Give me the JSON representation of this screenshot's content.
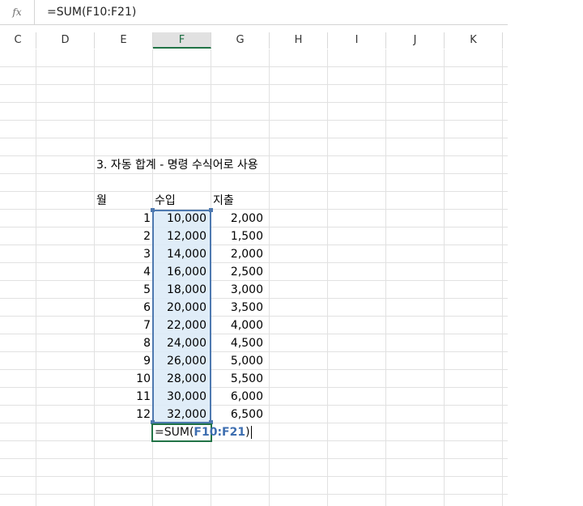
{
  "formula_bar": {
    "fx_label": "fx",
    "formula": "=SUM(F10:F21)"
  },
  "columns": [
    "C",
    "D",
    "E",
    "F",
    "G",
    "H",
    "I",
    "J",
    "K"
  ],
  "sheet": {
    "title": "3. 자동 합계 - 명령 수식어로 사용",
    "headers": {
      "month": "월",
      "income": "수입",
      "expense": "지출"
    },
    "rows": [
      {
        "month": "1",
        "income": "10,000",
        "expense": "2,000"
      },
      {
        "month": "2",
        "income": "12,000",
        "expense": "1,500"
      },
      {
        "month": "3",
        "income": "14,000",
        "expense": "2,000"
      },
      {
        "month": "4",
        "income": "16,000",
        "expense": "2,500"
      },
      {
        "month": "5",
        "income": "18,000",
        "expense": "3,000"
      },
      {
        "month": "6",
        "income": "20,000",
        "expense": "3,500"
      },
      {
        "month": "7",
        "income": "22,000",
        "expense": "4,000"
      },
      {
        "month": "8",
        "income": "24,000",
        "expense": "4,500"
      },
      {
        "month": "9",
        "income": "26,000",
        "expense": "5,000"
      },
      {
        "month": "10",
        "income": "28,000",
        "expense": "5,500"
      },
      {
        "month": "11",
        "income": "30,000",
        "expense": "6,000"
      },
      {
        "month": "12",
        "income": "32,000",
        "expense": "6,500"
      }
    ],
    "editing": {
      "prefix": "=SUM(",
      "range": "F10:F21",
      "suffix": ")"
    }
  }
}
